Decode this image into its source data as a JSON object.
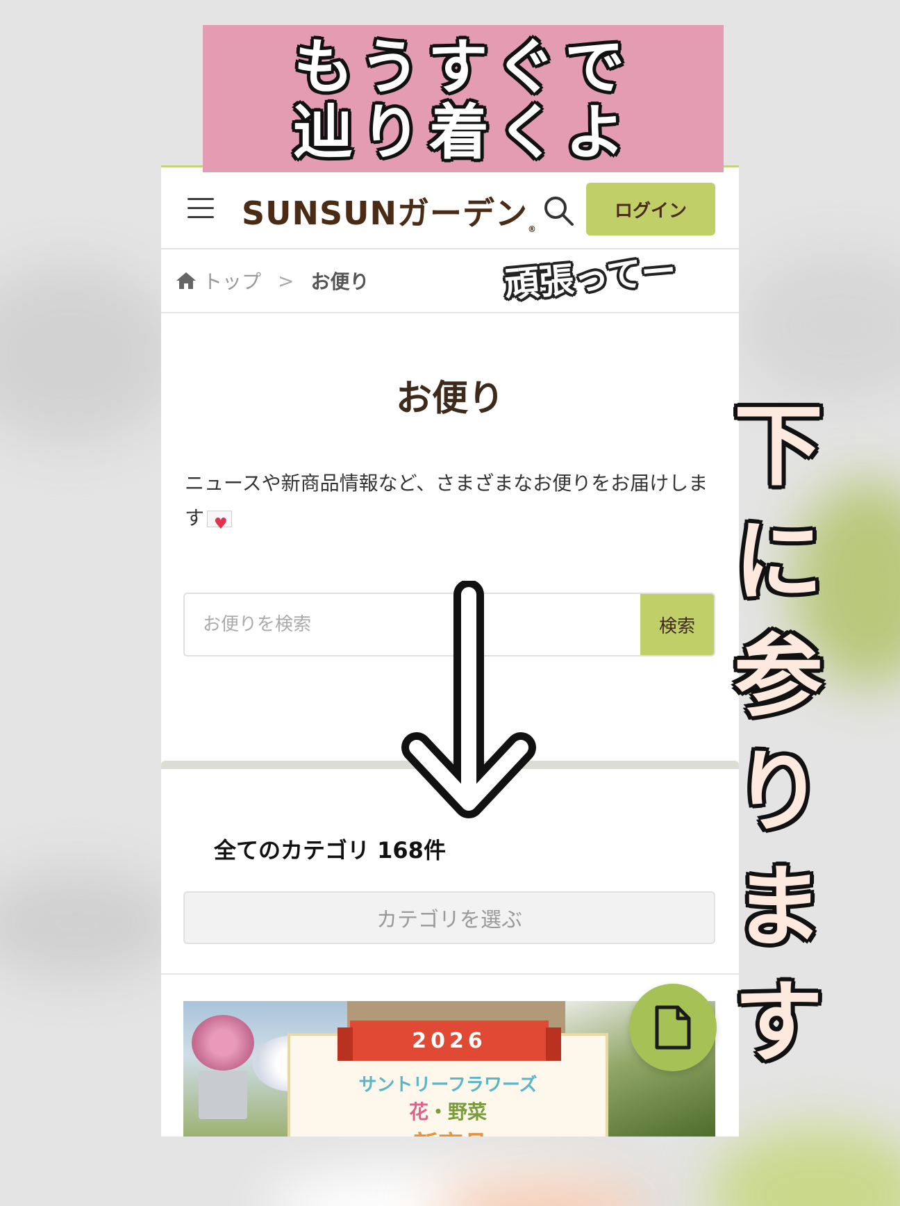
{
  "overlay": {
    "title_line1": "もうすぐで",
    "title_line2": "辿り着くよ",
    "side_note": "頑張ってー",
    "vertical_chars": [
      "下",
      "に",
      "参",
      "り",
      "ま",
      "す"
    ]
  },
  "header": {
    "logo": "SUNSUNガーデン",
    "logo_reg": "®",
    "login_label": "ログイン"
  },
  "breadcrumb": {
    "top": "トップ",
    "separator": ">",
    "current": "お便り"
  },
  "main": {
    "title": "お便り",
    "description": "ニュースや新商品情報など、さまざまなお便りをお届けします",
    "search_placeholder": "お便りを検索",
    "search_button": "検索",
    "category_count": "全てのカテゴリ 168件",
    "category_select": "カテゴリを選ぶ"
  },
  "banner": {
    "year": "2026",
    "line1": "サントリーフラワーズ",
    "line2_a": "花",
    "line2_sep": "・",
    "line2_b": "野菜",
    "line3": "新商品"
  },
  "colors": {
    "accent": "#c1cf69",
    "brand_brown": "#4a2c16",
    "overlay_pink": "#e39cb2",
    "fab_green": "#a6c155"
  },
  "icons": [
    "menu-icon",
    "search-icon",
    "home-icon",
    "document-icon",
    "down-arrow-icon",
    "letter-heart-icon"
  ]
}
